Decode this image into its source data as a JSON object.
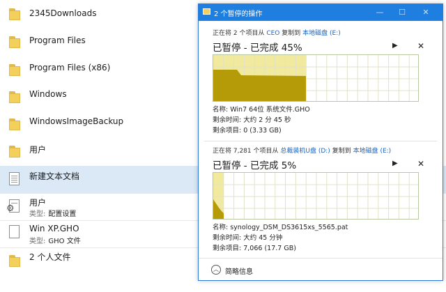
{
  "explorer": {
    "items": [
      {
        "name": "2345Downloads",
        "icon": "folder-icon"
      },
      {
        "name": "Program Files",
        "icon": "folder-icon"
      },
      {
        "name": "Program Files (x86)",
        "icon": "folder-icon"
      },
      {
        "name": "Windows",
        "icon": "folder-icon"
      },
      {
        "name": "WindowsImageBackup",
        "icon": "folder-icon"
      },
      {
        "name": "用户",
        "icon": "folder-icon"
      },
      {
        "name": "新建文本文档",
        "icon": "text-document-icon"
      },
      {
        "name": "用户",
        "icon": "settings-file-icon",
        "type_label": "类型:",
        "type_value": "配置设置"
      },
      {
        "name": "Win XP.GHO",
        "icon": "file-icon",
        "type_label": "类型:",
        "type_value": "GHO 文件"
      },
      {
        "name": "2 个人文件",
        "icon": "folder-icon"
      }
    ]
  },
  "dialog": {
    "title": "2 个暂停的操作",
    "accent_color": "#1e7fe0",
    "operations": [
      {
        "status_prefix": "正在将 2 个项目从",
        "source": "CEO",
        "copy_to": "复制到",
        "destination": "本地磁盘 (E:)",
        "headline": "已暂停 - 已完成 45%",
        "progress": 45,
        "name_label": "名称:",
        "name_value": "Win7 64位 系统文件.GHO",
        "time_label": "剩余时间:",
        "time_value": "大约 2 分 45 秒",
        "items_label": "剩余项目:",
        "items_value": "0 (3.33 GB)"
      },
      {
        "status_prefix": "正在将 7,281 个项目从",
        "source": "总裁装机U盘 (D:)",
        "copy_to": "复制到",
        "destination": "本地磁盘 (E:)",
        "headline": "已暂停 - 已完成 5%",
        "progress": 5,
        "name_label": "名称:",
        "name_value": "synology_DSM_DS3615xs_5565.pat",
        "time_label": "剩余时间:",
        "time_value": "大约 45 分钟",
        "items_label": "剩余项目:",
        "items_value": "7,066 (17.7 GB)"
      }
    ],
    "footer_label": "简略信息"
  }
}
